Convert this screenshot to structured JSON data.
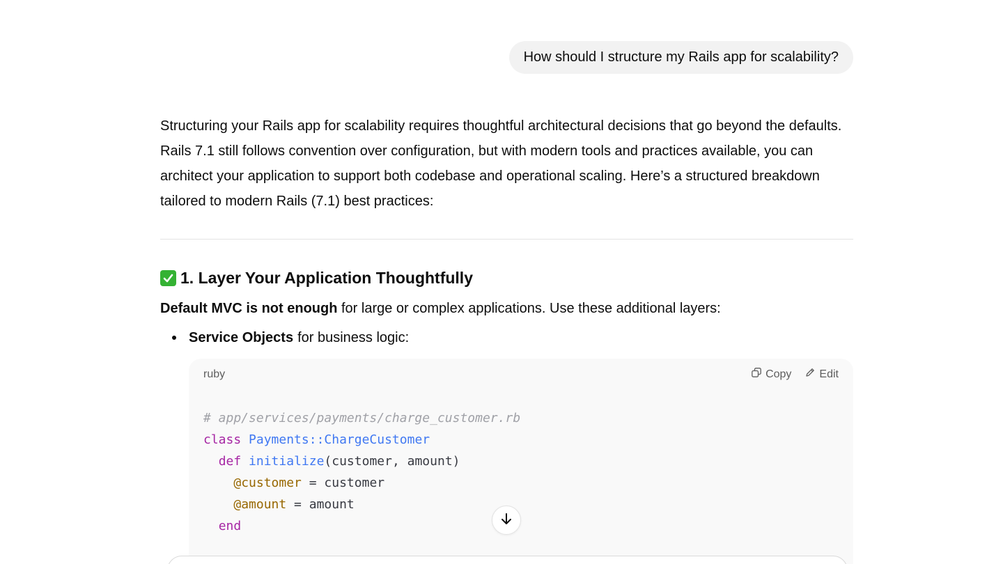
{
  "conversation": {
    "user_message": "How should I structure my Rails app for scalability?",
    "intro": "Structuring your Rails app for scalability requires thoughtful architectural decisions that go beyond the defaults. Rails 7.1 still follows convention over configuration, but with modern tools and practices available, you can architect your application to support both codebase and operational scaling. Here’s a structured breakdown tailored to modern Rails (7.1) best practices:",
    "section": {
      "icon": "check-mark-button-icon",
      "heading": "1. Layer Your Application Thoughtfully",
      "lead_bold": "Default MVC is not enough",
      "lead_rest": " for large or complex applications. Use these additional layers:",
      "bullet_bold": "Service Objects",
      "bullet_rest": "for business logic:"
    }
  },
  "code_block": {
    "language": "ruby",
    "copy_label": "Copy",
    "edit_label": "Edit",
    "line1_comment": "# app/services/payments/charge_customer.rb",
    "line2_kw": "class",
    "line2_const": "Payments::ChargeCustomer",
    "line3_kw": "def",
    "line3_fn": "initialize",
    "line3_rest": "(customer, amount)",
    "line4_ivar": "@customer",
    "line4_rest": " = customer",
    "line5_ivar": "@amount",
    "line5_rest": " = amount",
    "line6_kw": "end"
  },
  "controls": {
    "scroll_icon": "arrow-down-icon"
  },
  "colors": {
    "user_bubble": "#f2f2f2",
    "code_bg": "#f9f9f9",
    "keyword": "#a626a4",
    "constant": "#4078f2",
    "ivar": "#986801",
    "comment": "#a0a1a7"
  }
}
